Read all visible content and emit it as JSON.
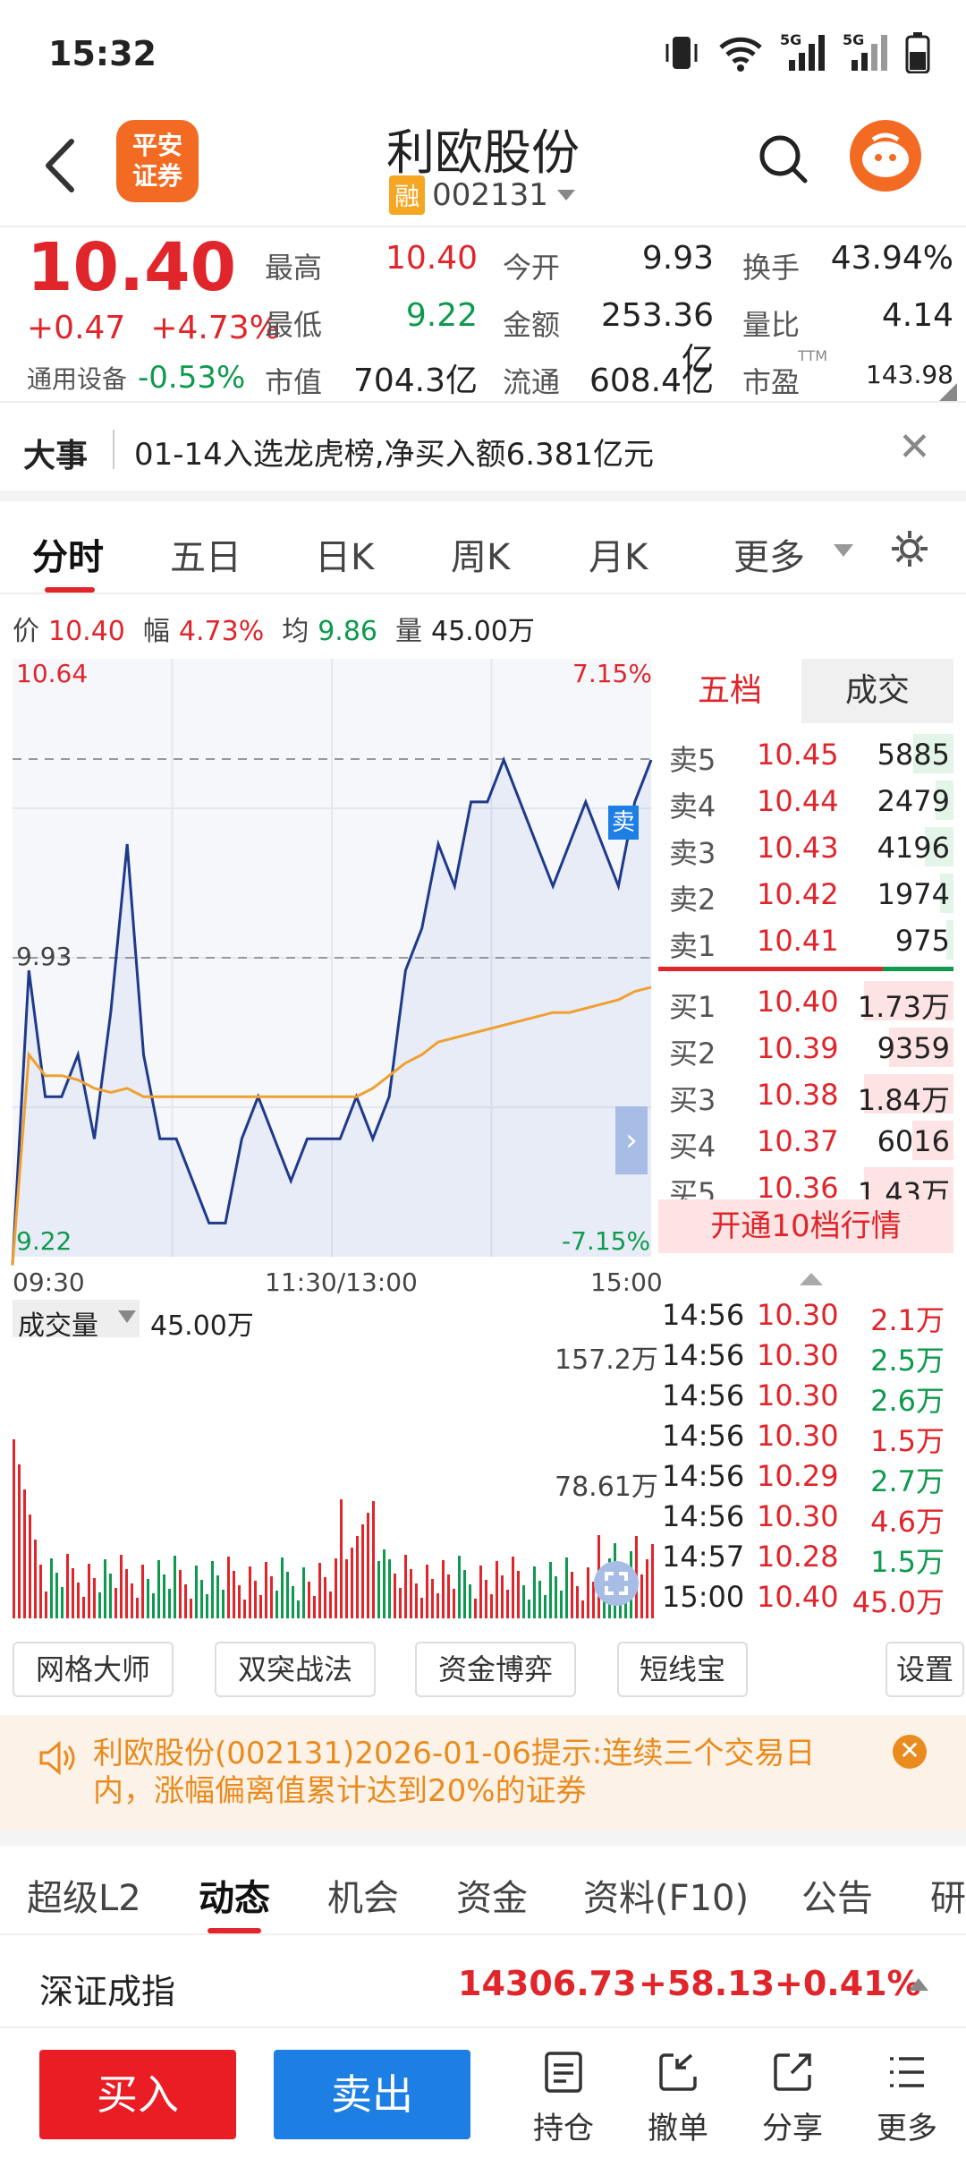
{
  "status_bar": {
    "time": "15:32",
    "signal_label_1": "5G",
    "signal_label_2": "5G"
  },
  "header": {
    "logo_line1": "平安",
    "logo_line2": "证券",
    "stock_name": "利欧股份",
    "margin_badge": "融",
    "stock_code": "002131"
  },
  "quote": {
    "price": "10.40",
    "change": "+0.47",
    "change_pct": "+4.73%",
    "sector_name": "通用设备",
    "sector_change": "-0.53%",
    "high_label": "最高",
    "high": "10.40",
    "open_label": "今开",
    "open": "9.93",
    "turnover_label": "换手",
    "turnover": "43.94%",
    "low_label": "最低",
    "low": "9.22",
    "amount_label": "金额",
    "amount": "253.36亿",
    "volratio_label": "量比",
    "volratio": "4.14",
    "mktcap_label": "市值",
    "mktcap": "704.3亿",
    "float_label": "流通",
    "float": "608.4亿",
    "pe_label": "市盈",
    "pe_sup": "TTM",
    "pe": "143.98"
  },
  "news": {
    "tag": "大事",
    "text": "01-14入选龙虎榜,净买入额6.381亿元"
  },
  "chart_tabs": [
    "分时",
    "五日",
    "日K",
    "周K",
    "月K",
    "更多"
  ],
  "info_row": {
    "price_label": "价",
    "price": "10.40",
    "amp_label": "幅",
    "amp": "4.73%",
    "avg_label": "均",
    "avg": "9.86",
    "vol_label": "量",
    "vol": "45.00万"
  },
  "chart_axes": {
    "top_price": "10.64",
    "top_pct": "7.15%",
    "mid_price": "9.93",
    "bottom_price": "9.22",
    "bottom_pct": "-7.15%",
    "time_start": "09:30",
    "time_mid": "11:30/13:00",
    "time_end": "15:00",
    "sell_marker": "卖"
  },
  "chart_data": {
    "type": "line",
    "x_label_ticks": [
      "09:30",
      "11:30/13:00",
      "15:00"
    ],
    "ylim": [
      9.22,
      10.64
    ],
    "prev_close": 9.93,
    "series": [
      {
        "name": "价",
        "values": [
          9.2,
          9.9,
          9.6,
          9.6,
          9.7,
          9.5,
          9.8,
          10.2,
          9.7,
          9.5,
          9.5,
          9.4,
          9.3,
          9.3,
          9.5,
          9.6,
          9.5,
          9.4,
          9.5,
          9.5,
          9.5,
          9.6,
          9.5,
          9.6,
          9.9,
          10.0,
          10.2,
          10.1,
          10.3,
          10.3,
          10.4,
          10.3,
          10.2,
          10.1,
          10.2,
          10.3,
          10.2,
          10.1,
          10.3,
          10.4
        ]
      },
      {
        "name": "均",
        "values": [
          9.2,
          9.7,
          9.65,
          9.65,
          9.64,
          9.62,
          9.61,
          9.62,
          9.6,
          9.6,
          9.6,
          9.6,
          9.6,
          9.6,
          9.6,
          9.6,
          9.6,
          9.6,
          9.6,
          9.6,
          9.6,
          9.6,
          9.62,
          9.65,
          9.68,
          9.7,
          9.73,
          9.74,
          9.75,
          9.76,
          9.77,
          9.78,
          9.79,
          9.8,
          9.8,
          9.81,
          9.82,
          9.83,
          9.85,
          9.86
        ]
      }
    ]
  },
  "order_book": {
    "tab_levels": "五档",
    "tab_trades": "成交",
    "asks": [
      {
        "label": "卖5",
        "price": "10.45",
        "vol": "5885",
        "fill": 0.45
      },
      {
        "label": "卖4",
        "price": "10.44",
        "vol": "2479",
        "fill": 0.2
      },
      {
        "label": "卖3",
        "price": "10.43",
        "vol": "4196",
        "fill": 0.32
      },
      {
        "label": "卖2",
        "price": "10.42",
        "vol": "1974",
        "fill": 0.15
      },
      {
        "label": "卖1",
        "price": "10.41",
        "vol": "975",
        "fill": 0.08
      }
    ],
    "bids": [
      {
        "label": "买1",
        "price": "10.40",
        "vol": "1.73万",
        "fill": 1.0
      },
      {
        "label": "买2",
        "price": "10.39",
        "vol": "9359",
        "fill": 0.72
      },
      {
        "label": "买3",
        "price": "10.38",
        "vol": "1.84万",
        "fill": 1.0
      },
      {
        "label": "买4",
        "price": "10.37",
        "vol": "6016",
        "fill": 0.46
      },
      {
        "label": "买5",
        "price": "10.36",
        "vol": "1.43万",
        "fill": 1.0
      }
    ],
    "open_l2": "开通10档行情"
  },
  "volume_panel": {
    "label": "成交量",
    "current": "45.00万",
    "tick_high": "157.2万",
    "tick_mid": "78.61万"
  },
  "trades": [
    {
      "time": "14:56",
      "price": "10.30",
      "vol": "2.1万",
      "side": "red"
    },
    {
      "time": "14:56",
      "price": "10.30",
      "vol": "2.5万",
      "side": "green"
    },
    {
      "time": "14:56",
      "price": "10.30",
      "vol": "2.6万",
      "side": "green"
    },
    {
      "time": "14:56",
      "price": "10.30",
      "vol": "1.5万",
      "side": "red"
    },
    {
      "time": "14:56",
      "price": "10.29",
      "vol": "2.7万",
      "side": "green"
    },
    {
      "time": "14:56",
      "price": "10.30",
      "vol": "4.6万",
      "side": "red"
    },
    {
      "time": "14:57",
      "price": "10.28",
      "vol": "1.5万",
      "side": "green"
    },
    {
      "time": "15:00",
      "price": "10.40",
      "vol": "45.0万",
      "side": "red"
    }
  ],
  "tools": [
    "网格大师",
    "双突战法",
    "资金博弈",
    "短线宝",
    "设置"
  ],
  "alert": {
    "text": "利欧股份(002131)2026-01-06提示:连续三个交易日内，涨幅偏离值累计达到20%的证券"
  },
  "bottom_tabs": [
    "超级L2",
    "动态",
    "机会",
    "资金",
    "资料(F10)",
    "公告",
    "研"
  ],
  "index_row": {
    "name": "深证成指",
    "value": "14306.73",
    "change": "+58.13",
    "pct": "+0.41%"
  },
  "action_bar": {
    "buy": "买入",
    "sell": "卖出",
    "positions": "持仓",
    "cancel": "撤单",
    "share": "分享",
    "more": "更多"
  }
}
